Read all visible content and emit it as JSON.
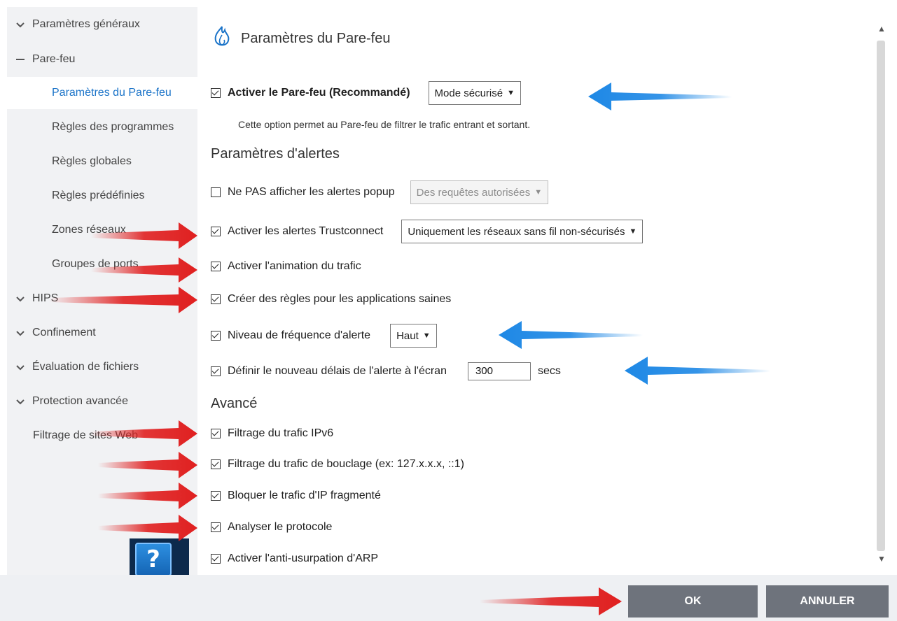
{
  "sidebar": {
    "items": [
      {
        "label": "Paramètres généraux",
        "type": "collapsed"
      },
      {
        "label": "Pare-feu",
        "type": "expanded"
      },
      {
        "label": "Paramètres du Pare-feu",
        "type": "sub",
        "active": true
      },
      {
        "label": "Règles des programmes",
        "type": "sub"
      },
      {
        "label": "Règles globales",
        "type": "sub"
      },
      {
        "label": "Règles prédéfinies",
        "type": "sub"
      },
      {
        "label": "Zones réseaux",
        "type": "sub"
      },
      {
        "label": "Groupes de ports",
        "type": "sub"
      },
      {
        "label": "HIPS",
        "type": "collapsed"
      },
      {
        "label": "Confinement",
        "type": "collapsed"
      },
      {
        "label": "Évaluation de fichiers",
        "type": "collapsed"
      },
      {
        "label": "Protection avancée",
        "type": "collapsed"
      },
      {
        "label": "Filtrage de sites Web",
        "type": "plain"
      }
    ],
    "help_glyph": "?"
  },
  "main": {
    "title": "Paramètres du Pare-feu",
    "firewall": {
      "label": "Activer le Pare-feu (Recommandé)",
      "checked": true,
      "mode": "Mode sécurisé",
      "description": "Cette option permet au Pare-feu de filtrer le trafic entrant et sortant."
    },
    "alerts_heading": "Paramètres d'alertes",
    "alerts": {
      "no_popup": {
        "label": "Ne PAS afficher les alertes popup",
        "checked": false,
        "select": "Des requêtes autorisées"
      },
      "trustconnect": {
        "label": "Activer les alertes Trustconnect",
        "checked": true,
        "select": "Uniquement les réseaux sans fil non-sécurisés"
      },
      "animation": {
        "label": "Activer l'animation du trafic",
        "checked": true
      },
      "rules": {
        "label": "Créer des règles pour les applications saines",
        "checked": true
      },
      "frequency": {
        "label": "Niveau de fréquence d'alerte",
        "checked": true,
        "select": "Haut"
      },
      "timeout": {
        "label": "Définir le nouveau délais de l'alerte à l'écran",
        "checked": true,
        "value": "300",
        "unit": "secs"
      }
    },
    "advanced_heading": "Avancé",
    "advanced": {
      "ipv6": {
        "label": "Filtrage du trafic IPv6",
        "checked": true
      },
      "loopback": {
        "label": "Filtrage du trafic de bouclage (ex: 127.x.x.x, ::1)",
        "checked": true
      },
      "fragmented": {
        "label": "Bloquer le trafic d'IP fragmenté",
        "checked": true
      },
      "protocol": {
        "label": "Analyser le protocole",
        "checked": true
      },
      "arp": {
        "label": "Activer l'anti-usurpation d'ARP",
        "checked": true
      }
    }
  },
  "footer": {
    "ok": "OK",
    "cancel": "ANNULER"
  },
  "colors": {
    "accent": "#1a73c8",
    "sidebar_bg": "#f1f2f4",
    "button": "#6e737c",
    "red_arrow": "#e02020",
    "blue_arrow": "#1e88e5"
  }
}
